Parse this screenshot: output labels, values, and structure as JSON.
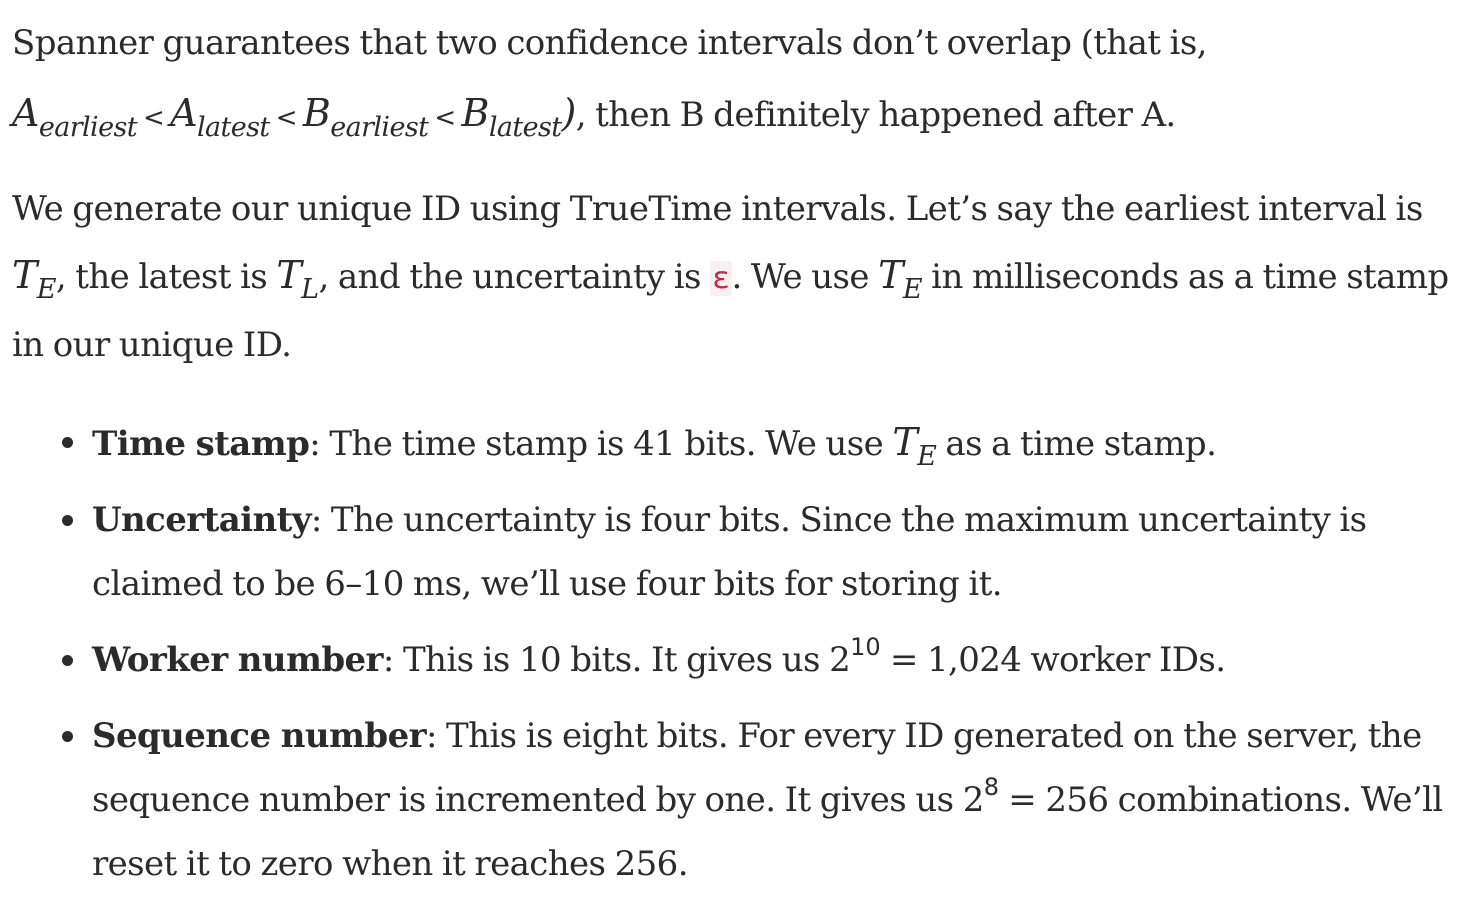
{
  "para1": {
    "lead": "Spanner guarantees that two confidence intervals don’t overlap (that is, ",
    "a_sym": "A",
    "a_earliest_sub": "earliest",
    "lt": "<",
    "a_latest_sub": "latest",
    "b_sym": "B",
    "b_earliest_sub": "earliest",
    "b_latest_sub": "latest",
    "close": ")",
    "trail": ", then B definitely happened after A."
  },
  "para2": {
    "lead": "We generate our unique ID using TrueTime intervals. Let’s say the earliest interval is ",
    "t_sym": "T",
    "e_sub": "E",
    "l_sub": "L",
    "mid1": ", the latest is ",
    "mid2": ", and the uncertainty is ",
    "epsilon": "ε",
    "mid3": ". We use ",
    "trail": " in milliseconds as a time stamp in our unique ID."
  },
  "bullets": [
    {
      "term": "Time stamp",
      "text_a": ": The time stamp is 41 bits. We use ",
      "text_b": " as a time stamp."
    },
    {
      "term": "Uncertainty",
      "text": ": The uncertainty is four bits. Since the maximum uncertainty is claimed to be 6–10 ms, we’ll use four bits for storing it."
    },
    {
      "term": "Worker number",
      "text_a": ": This is 10 bits. It gives us ",
      "base": "2",
      "exp": "10",
      "text_b": " = 1,024 worker IDs."
    },
    {
      "term": "Sequence number",
      "text_a": ": This is eight bits. For every ID generated on the server, the sequence number is incremented by one. It gives us ",
      "base": "2",
      "exp": "8",
      "text_b": " = 256 combinations. We’ll reset it to zero when it reaches 256."
    }
  ]
}
